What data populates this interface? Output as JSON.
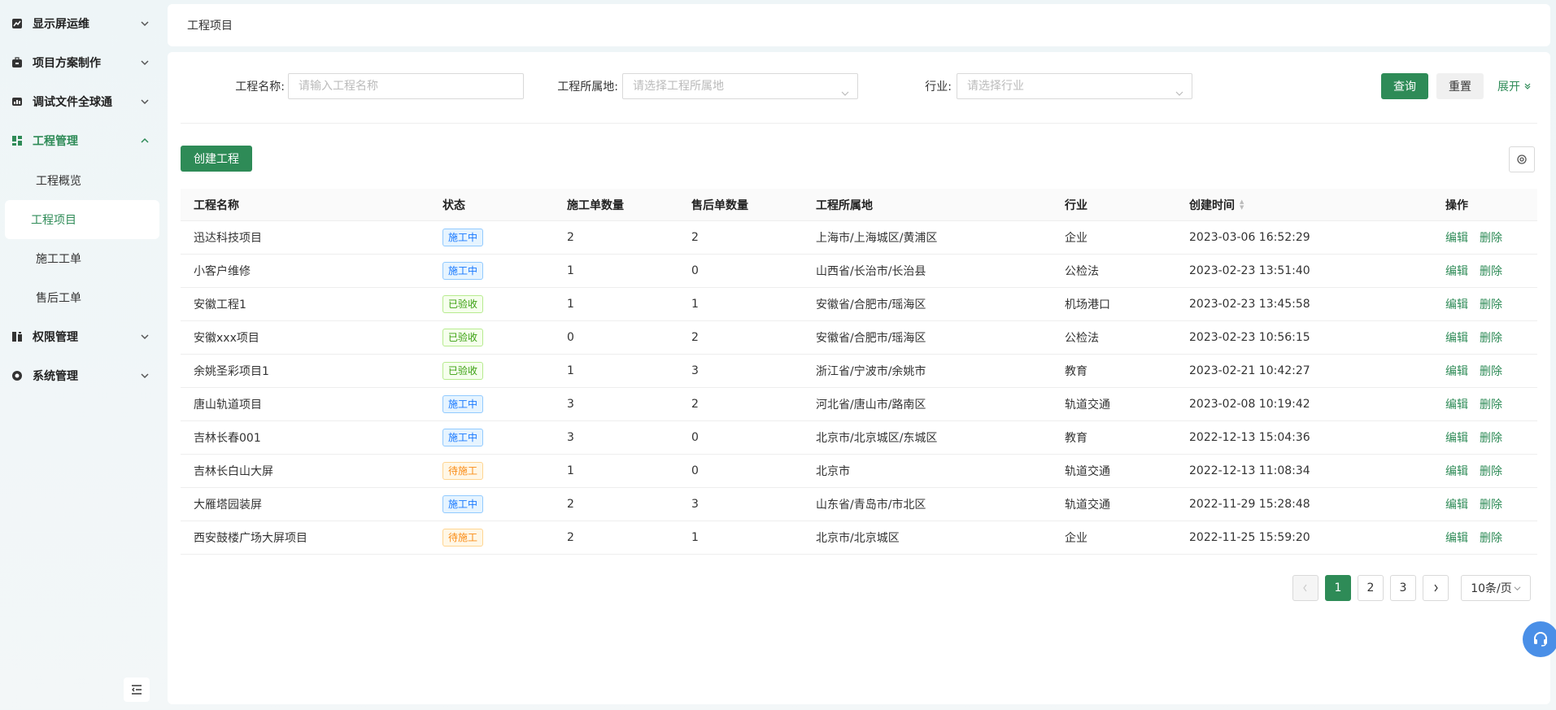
{
  "sidebar": {
    "groups": [
      {
        "label": "显示屏运维",
        "icon": "chart-icon"
      },
      {
        "label": "项目方案制作",
        "icon": "briefcase-icon"
      },
      {
        "label": "调试文件全球通",
        "icon": "dashboard-icon"
      },
      {
        "label": "工程管理",
        "icon": "grid-icon"
      },
      {
        "label": "权限管理",
        "icon": "permission-icon"
      },
      {
        "label": "系统管理",
        "icon": "system-icon"
      }
    ],
    "sub_items": [
      "工程概览",
      "工程项目",
      "施工工单",
      "售后工单"
    ],
    "active_sub": "工程项目"
  },
  "breadcrumb": "工程项目",
  "filters": {
    "name_label": "工程名称:",
    "name_placeholder": "请输入工程名称",
    "location_label": "工程所属地:",
    "location_placeholder": "请选择工程所属地",
    "industry_label": "行业:",
    "industry_placeholder": "请选择行业",
    "query": "查询",
    "reset": "重置",
    "expand": "展开"
  },
  "create_button": "创建工程",
  "table": {
    "headers": [
      "工程名称",
      "状态",
      "施工单数量",
      "售后单数量",
      "工程所属地",
      "行业",
      "创建时间",
      "操作"
    ],
    "edit": "编辑",
    "delete": "删除",
    "rows": [
      {
        "name": "迅达科技项目",
        "status": "施工中",
        "build": "2",
        "after": "2",
        "location": "上海市/上海城区/黄浦区",
        "industry": "企业",
        "created": "2023-03-06 16:52:29"
      },
      {
        "name": "小客户维修",
        "status": "施工中",
        "build": "1",
        "after": "0",
        "location": "山西省/长治市/长治县",
        "industry": "公检法",
        "created": "2023-02-23 13:51:40"
      },
      {
        "name": "安徽工程1",
        "status": "已验收",
        "build": "1",
        "after": "1",
        "location": "安徽省/合肥市/瑶海区",
        "industry": "机场港口",
        "created": "2023-02-23 13:45:58"
      },
      {
        "name": "安徽xxx项目",
        "status": "已验收",
        "build": "0",
        "after": "2",
        "location": "安徽省/合肥市/瑶海区",
        "industry": "公检法",
        "created": "2023-02-23 10:56:15"
      },
      {
        "name": "余姚圣彩项目1",
        "status": "已验收",
        "build": "1",
        "after": "3",
        "location": "浙江省/宁波市/余姚市",
        "industry": "教育",
        "created": "2023-02-21 10:42:27"
      },
      {
        "name": "唐山轨道项目",
        "status": "施工中",
        "build": "3",
        "after": "2",
        "location": "河北省/唐山市/路南区",
        "industry": "轨道交通",
        "created": "2023-02-08 10:19:42"
      },
      {
        "name": "吉林长春001",
        "status": "施工中",
        "build": "3",
        "after": "0",
        "location": "北京市/北京城区/东城区",
        "industry": "教育",
        "created": "2022-12-13 15:04:36"
      },
      {
        "name": "吉林长白山大屏",
        "status": "待施工",
        "build": "1",
        "after": "0",
        "location": "北京市",
        "industry": "轨道交通",
        "created": "2022-12-13 11:08:34"
      },
      {
        "name": "大雁塔园装屏",
        "status": "施工中",
        "build": "2",
        "after": "3",
        "location": "山东省/青岛市/市北区",
        "industry": "轨道交通",
        "created": "2022-11-29 15:28:48"
      },
      {
        "name": "西安鼓楼广场大屏项目",
        "status": "待施工",
        "build": "2",
        "after": "1",
        "location": "北京市/北京城区",
        "industry": "企业",
        "created": "2022-11-25 15:59:20"
      }
    ]
  },
  "pagination": {
    "pages": [
      "1",
      "2",
      "3"
    ],
    "current": "1",
    "page_size": "10条/页"
  },
  "status_colors": {
    "施工中": "#1677ff",
    "已验收": "#389e0d",
    "待施工": "#fa8c16"
  },
  "accent_color": "#2e8b57"
}
